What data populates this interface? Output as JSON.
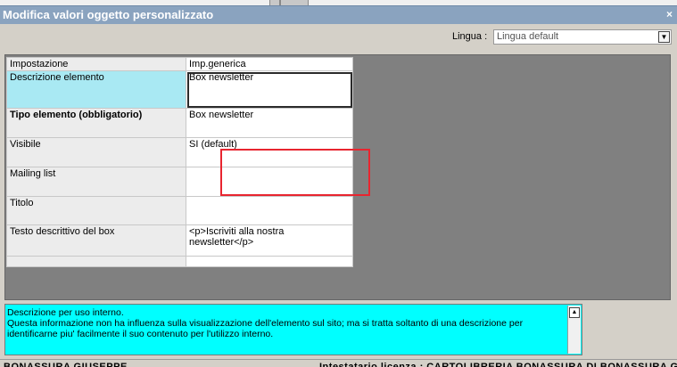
{
  "window": {
    "title": "Modifica valori oggetto personalizzato",
    "close_glyph": "×"
  },
  "lingua": {
    "label": "Lingua :",
    "value": "Lingua default"
  },
  "table": {
    "headers": [
      "Impostazione",
      "Imp.generica"
    ],
    "rows": [
      {
        "name": "Descrizione elemento",
        "value": "Box newsletter"
      },
      {
        "name": "Tipo elemento (obbligatorio)",
        "value": "Box newsletter"
      },
      {
        "name": "Visibile",
        "value": "SI (default)"
      },
      {
        "name": "Mailing list",
        "value": ""
      },
      {
        "name": "Titolo",
        "value": ""
      },
      {
        "name": "Testo descrittivo del box",
        "value": "<p>Iscriviti alla nostra newsletter</p>"
      },
      {
        "name": "",
        "value": ""
      }
    ]
  },
  "description": {
    "line1": "Descrizione per uso interno.",
    "line2": "Questa informazione non ha influenza sulla visualizzazione dell'elemento sul sito; ma si tratta soltanto di una descrizione per identificarne piu' facilmente il suo contenuto per l'utilizzo interno."
  },
  "status": {
    "left": "BONASSURA GIUSEPPE",
    "right": "Intestatario licenza : CARTOLIBRERIA BONASSURA DI BONASSURA GI"
  },
  "colors": {
    "titlebar": "#8aa3bf",
    "selected_row": "#a9e9f3",
    "description_bg": "#00ffff",
    "annotation_box": "#e8252f"
  },
  "icons": {
    "close": "close-icon",
    "dropdown": "chevron-down-icon",
    "scroll_up": "scroll-up-icon"
  }
}
